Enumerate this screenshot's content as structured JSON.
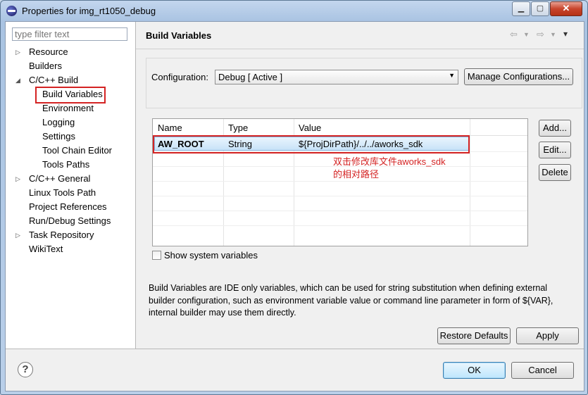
{
  "window": {
    "title": "Properties for img_rt1050_debug",
    "minimize_glyph": "▁",
    "maximize_glyph": "▢",
    "close_glyph": "✕"
  },
  "filter": {
    "placeholder": "type filter text"
  },
  "tree": [
    {
      "label": "Resource",
      "expandable": true
    },
    {
      "label": "Builders"
    },
    {
      "label": "C/C++ Build",
      "expanded": true
    },
    {
      "label": "Build Variables",
      "selected": true
    },
    {
      "label": "Environment"
    },
    {
      "label": "Logging"
    },
    {
      "label": "Settings"
    },
    {
      "label": "Tool Chain Editor"
    },
    {
      "label": "Tools Paths"
    },
    {
      "label": "C/C++ General",
      "expandable": true
    },
    {
      "label": "Linux Tools Path"
    },
    {
      "label": "Project References"
    },
    {
      "label": "Run/Debug Settings"
    },
    {
      "label": "Task Repository",
      "expandable": true
    },
    {
      "label": "WikiText"
    }
  ],
  "page": {
    "title": "Build Variables",
    "configuration_label": "Configuration:",
    "configuration_value": "Debug  [ Active ]",
    "manage_button": "Manage Configurations...",
    "table": {
      "columns": [
        "Name",
        "Type",
        "Value"
      ],
      "rows": [
        {
          "name": "AW_ROOT",
          "type": "String",
          "value": "${ProjDirPath}/../../aworks_sdk"
        }
      ]
    },
    "annotation_line1": "双击修改库文件aworks_sdk",
    "annotation_line2": "的相对路径",
    "add_button": "Add...",
    "edit_button": "Edit...",
    "delete_button": "Delete",
    "show_system_label": "Show system variables",
    "description": "Build Variables are IDE only variables, which can be used for string substitution when defining external builder configuration, such as environment variable value or command line parameter in form of ${VAR}, internal builder may use them directly.",
    "restore_button": "Restore Defaults",
    "apply_button": "Apply"
  },
  "footer": {
    "help_glyph": "?",
    "ok_button": "OK",
    "cancel_button": "Cancel"
  },
  "icons": {
    "back": "⇦",
    "forward": "⇨",
    "dropdown": "▼",
    "menu": "▾"
  },
  "colors": {
    "annotation": "#d42323",
    "selection": "#c8e3f8"
  }
}
